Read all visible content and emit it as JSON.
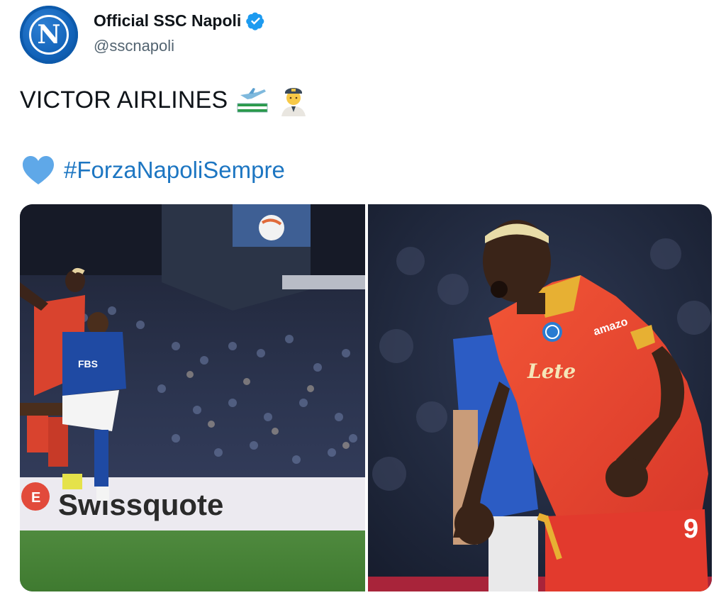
{
  "header": {
    "display_name": "Official SSC Napoli",
    "handle": "@sscnapoli",
    "avatar_letter": "N",
    "verified_icon": "verified-badge-icon"
  },
  "tweet": {
    "text": "VICTOR AIRLINES",
    "emojis": [
      "airplane-flag-icon",
      "pilot-emoji-icon"
    ],
    "hashtag": "#ForzaNapoliSempre",
    "hashtag_icon": "blue-heart-icon"
  },
  "media": {
    "left_photo": {
      "ad_board_text": "Swissquote",
      "badge_text": "E"
    },
    "right_photo": {
      "sponsor_text": "Lete",
      "chest_text": "amazo",
      "shirt_number": "9"
    }
  },
  "colors": {
    "link": "#1d76c2",
    "verified": "#1d9bf0",
    "napoli_blue": "#1162b8"
  }
}
